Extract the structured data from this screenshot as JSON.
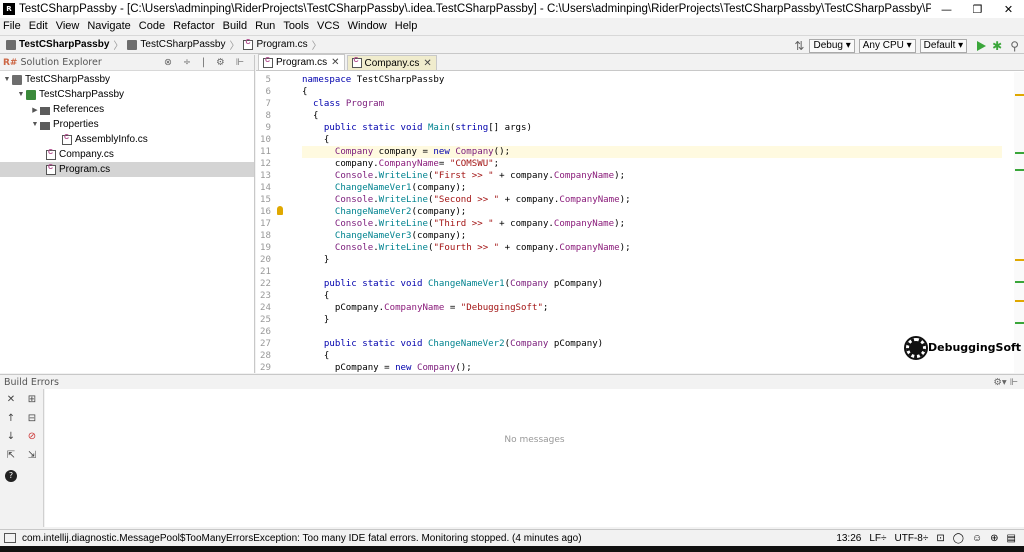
{
  "window": {
    "title": "TestCSharpPassby - [C:\\Users\\adminping\\RiderProjects\\TestCSharpPassby\\.idea.TestCSharpPassby] - C:\\Users\\adminping\\RiderProjects\\TestCSharpPassby\\TestCSharpPassby\\Program....",
    "minimize": "—",
    "restore": "❐",
    "close": "✕"
  },
  "menu": [
    "File",
    "Edit",
    "View",
    "Navigate",
    "Code",
    "Refactor",
    "Build",
    "Run",
    "Tools",
    "VCS",
    "Window",
    "Help"
  ],
  "breadcrumb": {
    "solution": "TestCSharpPassby",
    "project": "TestCSharpPassby",
    "file": "Program.cs"
  },
  "toolbar": {
    "config": "Debug ▾",
    "platform": "Any CPU ▾",
    "run_config": "Default ▾"
  },
  "solution_explorer": {
    "title": "Solution Explorer",
    "items": [
      {
        "label": "TestCSharpPassby",
        "toggle": "▼",
        "icon": "solution"
      },
      {
        "label": "TestCSharpPassby",
        "toggle": "▼",
        "icon": "project"
      },
      {
        "label": "References",
        "toggle": "▶",
        "icon": "references"
      },
      {
        "label": "Properties",
        "toggle": "▼",
        "icon": "folder"
      },
      {
        "label": "AssemblyInfo.cs",
        "toggle": "",
        "icon": "cs-file"
      },
      {
        "label": "Company.cs",
        "toggle": "",
        "icon": "cs-file"
      },
      {
        "label": "Program.cs",
        "toggle": "",
        "icon": "cs-file"
      }
    ]
  },
  "tabs": [
    {
      "label": "Program.cs",
      "close": "✕"
    },
    {
      "label": "Company.cs",
      "close": "✕"
    }
  ],
  "code": {
    "line_numbers": [
      "5",
      "6",
      "7",
      "8",
      "9",
      "10",
      "11",
      "12",
      "13",
      "14",
      "15",
      "16",
      "17",
      "18",
      "19",
      "20",
      "21",
      "22",
      "23",
      "24",
      "25",
      "26",
      "27",
      "28",
      "29"
    ]
  },
  "watermark": "DebuggingSoft",
  "build_errors": {
    "title": "Build Errors",
    "empty_text": "No messages"
  },
  "status": {
    "message": "com.intellij.diagnostic.MessagePool$TooManyErrorsException: Too many IDE fatal errors. Monitoring stopped. (4 minutes ago)",
    "position": "13:26",
    "line_sep": "LF÷",
    "encoding": "UTF-8÷"
  }
}
